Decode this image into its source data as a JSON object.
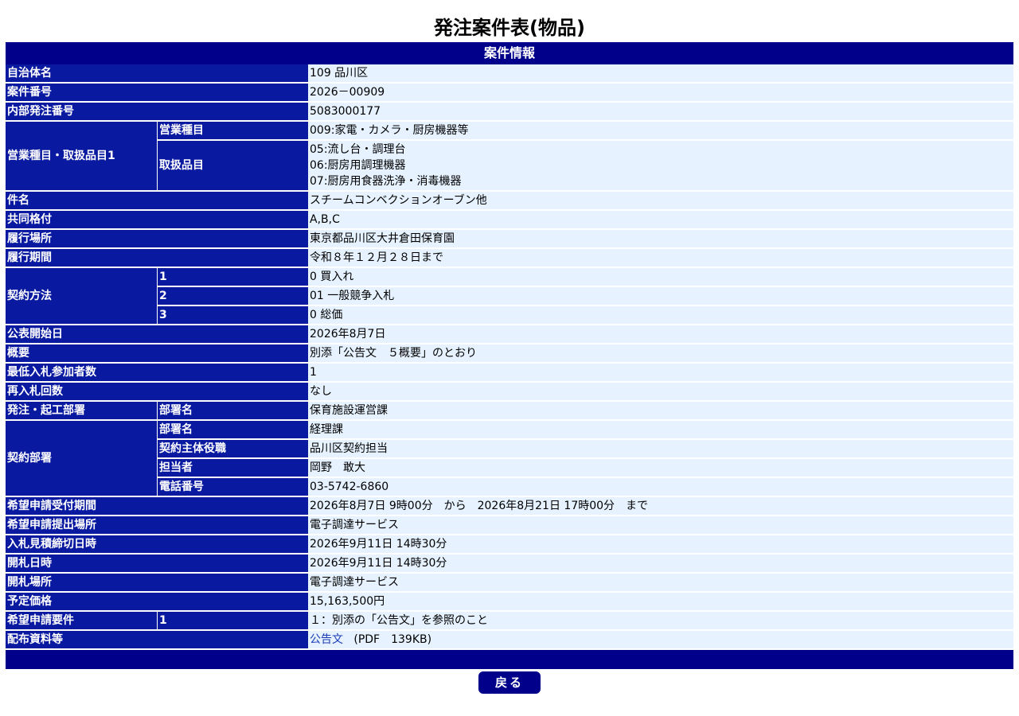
{
  "page_title": "発注案件表(物品)",
  "section_title": "案件情報",
  "rows": {
    "jichitai": {
      "label": "自治体名",
      "value": "109 品川区"
    },
    "anken_no": {
      "label": "案件番号",
      "value": "2026－00909"
    },
    "naibu_no": {
      "label": "内部発注番号",
      "value": "5083000177"
    },
    "eigyo": {
      "label": "営業種目・取扱品目1",
      "eigyo_label": "営業種目",
      "eigyo_value": "009:家電・カメラ・厨房機器等",
      "hinmoku_label": "取扱品目",
      "hinmoku_values": [
        "05:流し台・調理台",
        "06:厨房用調理機器",
        "07:厨房用食器洗浄・消毒機器"
      ]
    },
    "kenmei": {
      "label": "件名",
      "value": "スチームコンベクションオーブン他"
    },
    "kyodo": {
      "label": "共同格付",
      "value": "A,B,C"
    },
    "basho": {
      "label": "履行場所",
      "value": "東京都品川区大井倉田保育園"
    },
    "kikan": {
      "label": "履行期間",
      "value": "令和８年１２月２８日まで"
    },
    "keiyaku_hoho": {
      "label": "契約方法",
      "items": [
        {
          "num": "1",
          "value": "0 買入れ"
        },
        {
          "num": "2",
          "value": "01 一般競争入札"
        },
        {
          "num": "3",
          "value": "0 総価"
        }
      ]
    },
    "kohyo": {
      "label": "公表開始日",
      "value": "2026年8月7日"
    },
    "gaiyo": {
      "label": "概要",
      "value": "別添「公告文　５概要」のとおり"
    },
    "saitei": {
      "label": "最低入札参加者数",
      "value": "1"
    },
    "sainyusatsu": {
      "label": "再入札回数",
      "value": "なし"
    },
    "hacchu_busho": {
      "label": "発注・起工部署",
      "sub_label": "部署名",
      "value": "保育施設運営課"
    },
    "keiyaku_busho": {
      "label": "契約部署",
      "items": [
        {
          "label": "部署名",
          "value": "経理課"
        },
        {
          "label": "契約主体役職",
          "value": "品川区契約担当"
        },
        {
          "label": "担当者",
          "value": "岡野　敢大"
        },
        {
          "label": "電話番号",
          "value": "03-5742-6860"
        }
      ]
    },
    "uketsuke": {
      "label": "希望申請受付期間",
      "value": "2026年8月7日 9時00分　から　2026年8月21日 17時00分　まで"
    },
    "teishutsu": {
      "label": "希望申請提出場所",
      "value": "電子調達サービス"
    },
    "shimekiri": {
      "label": "入札見積締切日時",
      "value": "2026年9月11日 14時30分"
    },
    "kaisatsu_nichiji": {
      "label": "開札日時",
      "value": "2026年9月11日 14時30分"
    },
    "kaisatsu_basho": {
      "label": "開札場所",
      "value": "電子調達サービス"
    },
    "yotei": {
      "label": "予定価格",
      "value": "15,163,500円"
    },
    "yoken": {
      "label": "希望申請要件",
      "num": "1",
      "value": "１：別添の「公告文」を参照のこと"
    },
    "haifu": {
      "label": "配布資料等",
      "link_text": "公告文",
      "file_info": "(PDF　139KB)"
    }
  },
  "back_label": "戻る"
}
